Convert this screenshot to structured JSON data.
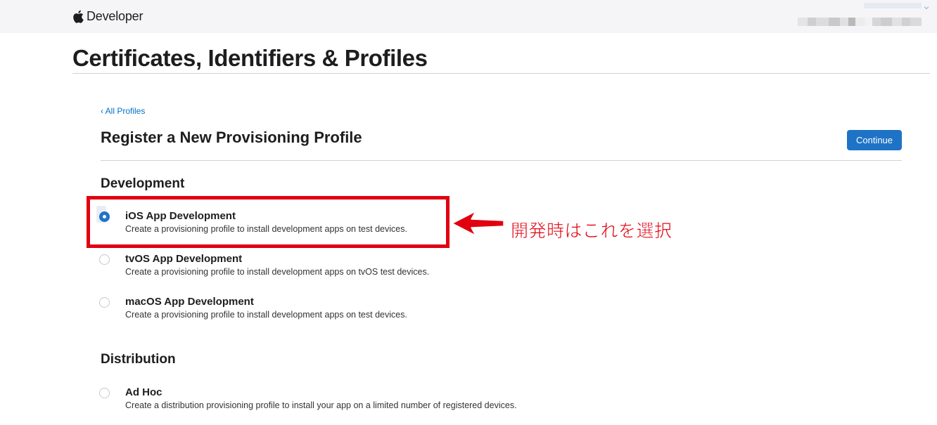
{
  "header": {
    "brand": "Developer",
    "brand_icon": "apple-logo-icon",
    "account_icon": "chevron-down-icon"
  },
  "page": {
    "title": "Certificates, Identifiers & Profiles"
  },
  "main": {
    "back_link": "‹ All Profiles",
    "section_title": "Register a New Provisioning Profile",
    "continue_label": "Continue"
  },
  "development": {
    "title": "Development",
    "options": [
      {
        "label": "iOS App Development",
        "description": "Create a provisioning profile to install development apps on test devices.",
        "selected": true
      },
      {
        "label": "tvOS App Development",
        "description": "Create a provisioning profile to install development apps on tvOS test devices.",
        "selected": false
      },
      {
        "label": "macOS App Development",
        "description": "Create a provisioning profile to install development apps on test devices.",
        "selected": false
      }
    ]
  },
  "distribution": {
    "title": "Distribution",
    "options": [
      {
        "label": "Ad Hoc",
        "description": "Create a distribution provisioning profile to install your app on a limited number of registered devices.",
        "selected": false
      }
    ]
  },
  "annotation": {
    "text": "開発時はこれを選択",
    "color": "#e1000f"
  },
  "colors": {
    "accent": "#1f73c6",
    "link": "#0070c9",
    "header_bg": "#f5f5f7"
  }
}
